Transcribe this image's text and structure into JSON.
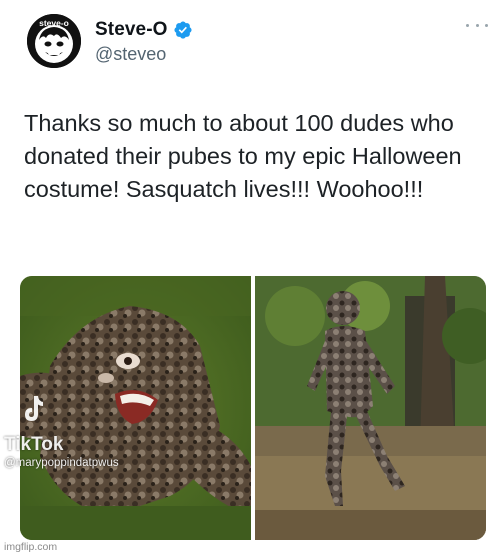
{
  "account": {
    "display_name": "Steve-O",
    "handle": "@steveo",
    "avatar_text": "steve-o",
    "verified": true
  },
  "tweet": {
    "text": "Thanks so much to about 100 dudes who donated their pubes to my epic Halloween costume! Sasquatch lives!!! Woohoo!!!"
  },
  "media": {
    "tiktok_label": "TikTok",
    "tiktok_user": "@marypoppindatpwus"
  },
  "watermark": "imgflip.com",
  "icons": {
    "verified": "verified-badge-icon",
    "more": "more-options-icon",
    "tiktok": "tiktok-logo-icon"
  },
  "colors": {
    "verified": "#1d9bf0",
    "handle": "#536471",
    "text": "#0f1419"
  }
}
